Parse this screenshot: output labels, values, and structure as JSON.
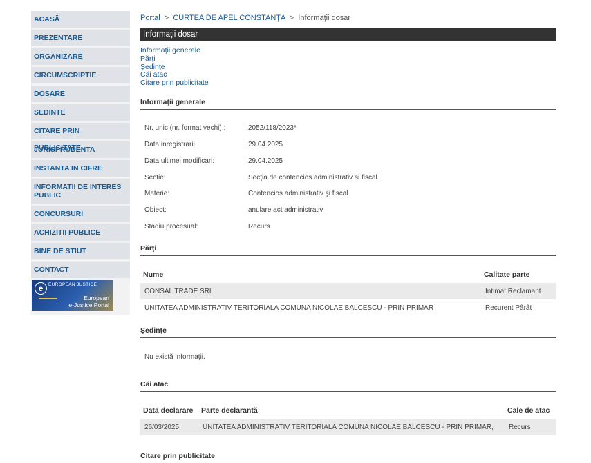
{
  "sidebar": {
    "items": [
      {
        "label": "ACASĂ"
      },
      {
        "label": "PREZENTARE"
      },
      {
        "label": "ORGANIZARE"
      },
      {
        "label": "CIRCUMSCRIPTIE"
      },
      {
        "label": "DOSARE"
      },
      {
        "label": "SEDINTE"
      },
      {
        "label": "CITARE PRIN PUBLICITATE"
      },
      {
        "label": "JURISPRUDENTA"
      },
      {
        "label": "INSTANTA IN CIFRE"
      },
      {
        "label": "INFORMATII DE INTERES PUBLIC"
      },
      {
        "label": "CONCURSURI"
      },
      {
        "label": "ACHIZITII PUBLICE"
      },
      {
        "label": "BINE DE STIUT"
      },
      {
        "label": "CONTACT"
      }
    ],
    "ejustice": {
      "top": "EUROPEAN JUSTICE",
      "bottom1": "European",
      "bottom2": "e-Justice Portal",
      "letter": "e"
    }
  },
  "breadcrumb": {
    "portal": "Portal",
    "sep": ">",
    "court": "CURTEA DE APEL CONSTANŢA",
    "current": "Informaţii dosar"
  },
  "title": "Informaţii dosar",
  "anchors": [
    "Informaţii generale",
    "Părţi",
    "Şedinţe",
    "Căi atac",
    "Citare prin publicitate"
  ],
  "general": {
    "heading": "Informaţii generale",
    "rows": [
      {
        "k": "Nr. unic (nr. format vechi) :",
        "v": "2052/118/2023*"
      },
      {
        "k": "Data inregistrarii",
        "v": "29.04.2025"
      },
      {
        "k": "Data ultimei modificari:",
        "v": "29.04.2025"
      },
      {
        "k": "Sectie:",
        "v": "Secţia de contencios administrativ si fiscal"
      },
      {
        "k": "Materie:",
        "v": "Contencios administrativ şi fiscal"
      },
      {
        "k": "Obiect:",
        "v": "anulare act administrativ"
      },
      {
        "k": "Stadiu procesual:",
        "v": "Recurs"
      }
    ]
  },
  "parti": {
    "heading": "Părţi",
    "col_name": "Nume",
    "col_role": "Calitate parte",
    "rows": [
      {
        "name": "CONSAL TRADE SRL",
        "role": "Intimat Reclamant"
      },
      {
        "name": "UNITATEA ADMINISTRATIV TERITORIALA COMUNA NICOLAE BALCESCU - PRIN PRIMAR",
        "role": "Recurent Pârât"
      }
    ]
  },
  "sedinte": {
    "heading": "Şedinţe",
    "empty": "Nu există informaţii."
  },
  "cai": {
    "heading": "Căi atac",
    "col_date": "Dată declarare",
    "col_party": "Parte declarantă",
    "col_type": "Cale de atac",
    "rows": [
      {
        "date": "26/03/2025",
        "party": "UNITATEA ADMINISTRATIV TERITORIALA COMUNA NICOLAE BALCESCU - PRIN PRIMAR,",
        "type": "Recurs"
      }
    ]
  },
  "citare": {
    "heading": "Citare prin publicitate"
  }
}
